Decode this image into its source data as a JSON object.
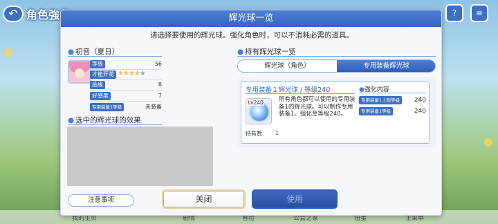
{
  "background": {
    "title": "角色強化",
    "nav": [
      "我的主页",
      "剧情",
      "冒险",
      "公会之家",
      "扭蛋",
      "主菜单"
    ]
  },
  "modal": {
    "title": "辉光球一览",
    "description": "请选择要使用的辉光球。强化角色时，可以不消耗必需的道具。",
    "character": {
      "name": "初音（夏日）",
      "stats": [
        {
          "label": "等级",
          "value": "56"
        },
        {
          "label": "才能开花",
          "stars": 5,
          "stars_filled": 4
        },
        {
          "label": "品级",
          "value": "8"
        },
        {
          "label": "好感度",
          "value": "7"
        },
        {
          "label": "专用装备1等级",
          "value": "未装备"
        }
      ]
    },
    "effect_section_title": "选中的辉光球的效果",
    "owned_section_title": "持有辉光球一览",
    "tabs": [
      {
        "label": "辉光球（角色）",
        "active": false
      },
      {
        "label": "专用装备辉光球",
        "active": true
      }
    ],
    "item": {
      "title": "专用装备１辉光球 / 等级240",
      "level_badge": "Lv240",
      "description": "所有角色都可以使用的专用装备1的辉光球。可以制作专用装备1、强化至等级240。",
      "owned_label": "持有数",
      "owned_count": "1",
      "boost_title": "强化内容",
      "boosts": [
        {
          "label": "专用装备1上限等级",
          "value": "240"
        },
        {
          "label": "专用装备1等级",
          "value": "240"
        }
      ]
    },
    "buttons": {
      "notes": "注意事项",
      "close": "关闭",
      "use": "使用"
    }
  }
}
